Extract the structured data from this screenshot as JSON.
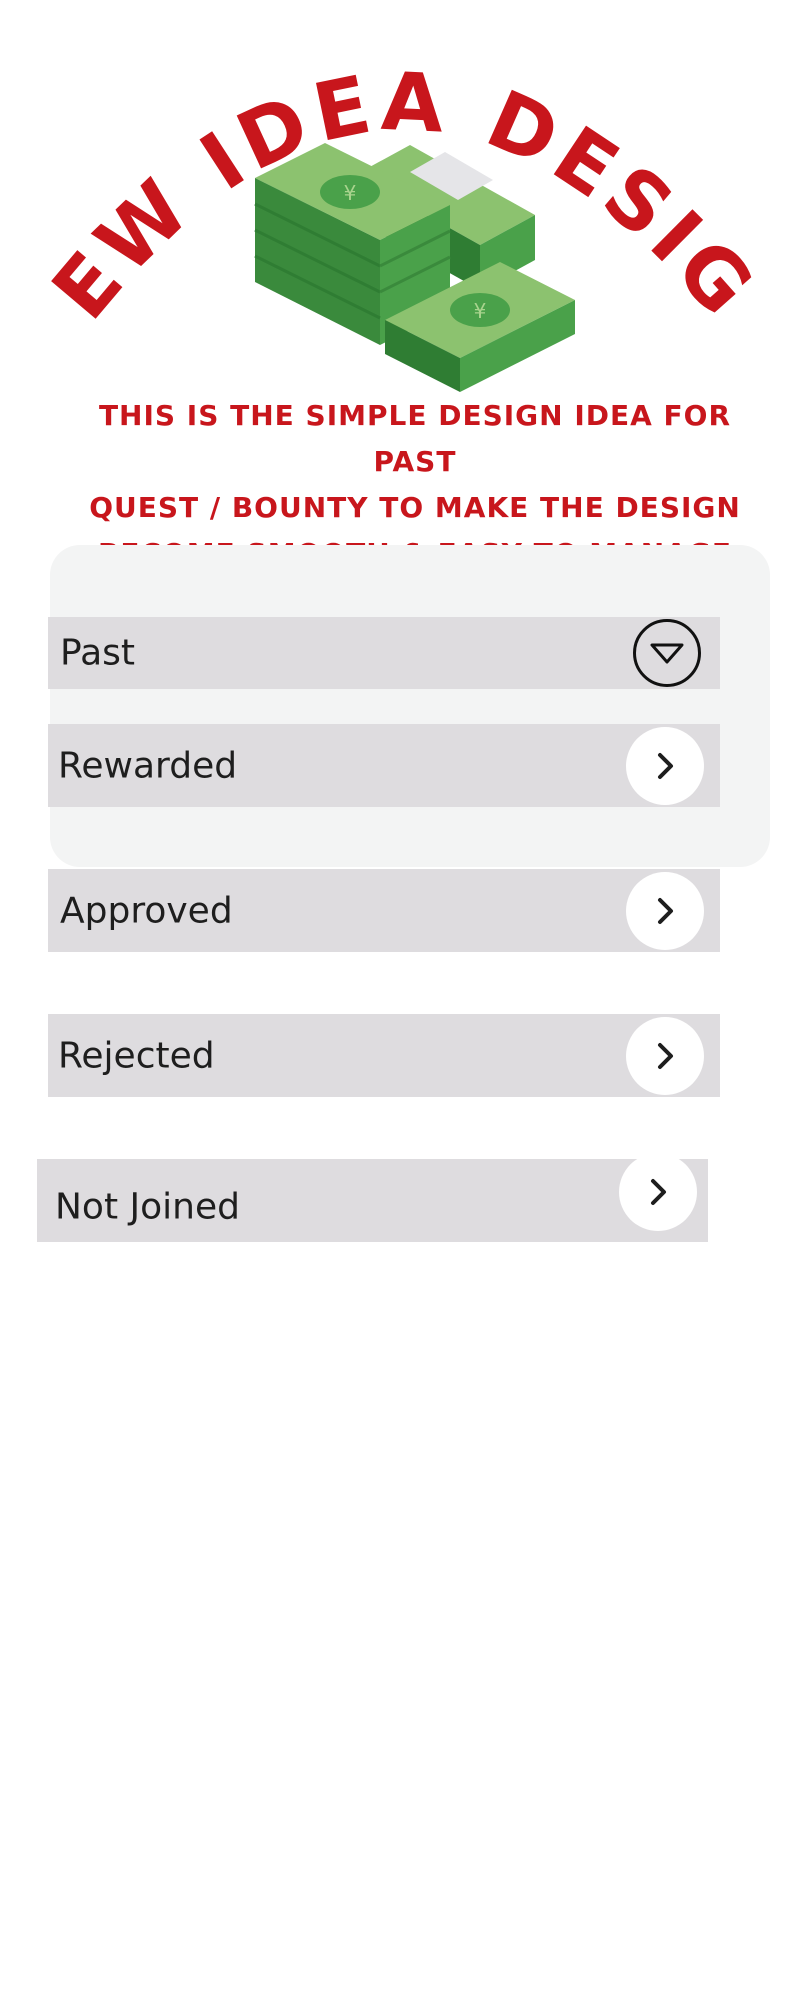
{
  "header": {
    "title": "NEW IDEA DESIGN",
    "subtitle_lines": [
      "THIS IS THE SIMPLE DESIGN IDEA FOR PAST",
      "QUEST / BOUNTY TO MAKE THE DESIGN",
      "BECOME SMOOTH & EASY TO MANAGE"
    ],
    "illustration_icon": "money-stack-icon",
    "currency_symbol": "¥"
  },
  "colors": {
    "accent_red": "#c8161c",
    "money_green": "#4aa14a",
    "row_background": "#dedcdf",
    "panel_background": "#f3f4f4"
  },
  "filter": {
    "selected": "Past",
    "icon": "dropdown-triangle-icon"
  },
  "statuses": [
    {
      "label": "Rewarded",
      "icon": "chevron-right-icon"
    },
    {
      "label": "Approved",
      "icon": "chevron-right-icon"
    },
    {
      "label": "Rejected",
      "icon": "chevron-right-icon"
    },
    {
      "label": "Not Joined",
      "icon": "chevron-right-icon"
    }
  ]
}
